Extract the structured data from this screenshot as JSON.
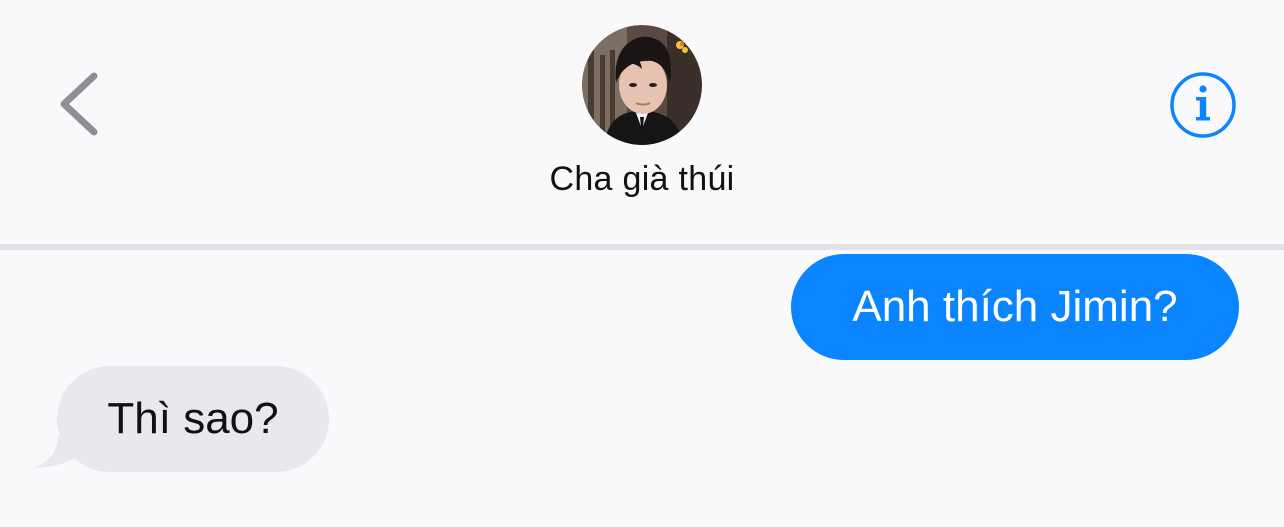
{
  "header": {
    "contact_name": "Cha già thúi",
    "back_icon": "chevron-left-icon",
    "info_icon": "info-circle-icon"
  },
  "messages": [
    {
      "direction": "outgoing",
      "text": "Anh thích Jimin?"
    },
    {
      "direction": "incoming",
      "text": "Thì sao?"
    }
  ],
  "colors": {
    "accent": "#0a84ff",
    "background": "#f9f9fb",
    "incoming_bubble": "#e9e8ee",
    "outgoing_bubble": "#0a84ff",
    "back_chevron": "#8e8e93"
  }
}
